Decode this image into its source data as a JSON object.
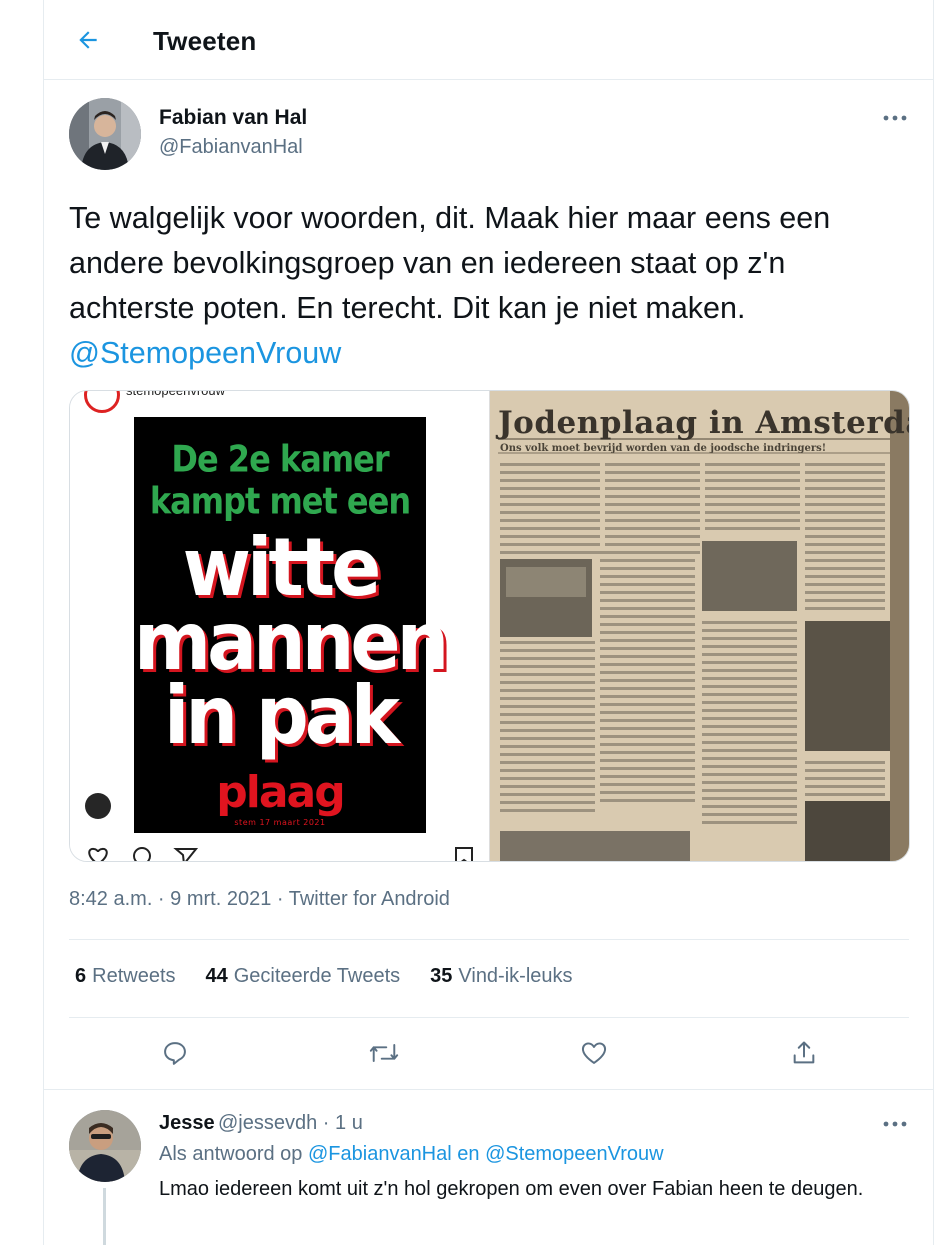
{
  "header": {
    "title": "Tweeten",
    "back_icon": "arrow-left-icon"
  },
  "tweet": {
    "author_name": "Fabian van Hal",
    "author_handle": "@FabianvanHal",
    "text": "Te walgelijk voor woorden, dit. Maak hier maar eens een andere bevolkingsgroep van en iedereen staat op z'n achterste poten. En terecht. Dit kan je niet maken.",
    "mention": "@StemopeenVrouw",
    "media": {
      "instagram_account": "stemopeenvrouw",
      "poster_lines": {
        "green_1": "De 2e kamer",
        "green_2": "kampt met een",
        "white_1": "witte",
        "white_2": "mannen",
        "white_3": "in pak",
        "red_1": "plaag",
        "red_small": "stem 17 maart 2021"
      },
      "newspaper_headline": "Jodenplaag in Amsterdam",
      "newspaper_subhead": "Ons volk moet bevrijd worden van de joodsche indringers!"
    },
    "timestamp": "8:42 a.m. · 9 mrt. 2021 · Twitter for Android",
    "stats": {
      "retweets_count": "6",
      "retweets_label": "Retweets",
      "quotes_count": "44",
      "quotes_label": "Geciteerde Tweets",
      "likes_count": "35",
      "likes_label": "Vind-ik-leuks"
    },
    "actions": [
      "reply-icon",
      "retweet-icon",
      "like-icon",
      "share-icon"
    ]
  },
  "reply": {
    "author_name": "Jesse",
    "meta": "@jessevdh · 1 u",
    "reply_to_prefix": "Als antwoord op",
    "reply_to_user_1": "@FabianvanHal",
    "reply_to_join": "en",
    "reply_to_user_2": "@StemopeenVrouw",
    "text": "Lmao iedereen komt uit z'n hol gekropen om even over Fabian heen te deugen."
  },
  "colors": {
    "accent": "#1b95e0",
    "muted": "#5b7083",
    "text": "#0f1419",
    "border": "#e6ecf0"
  }
}
